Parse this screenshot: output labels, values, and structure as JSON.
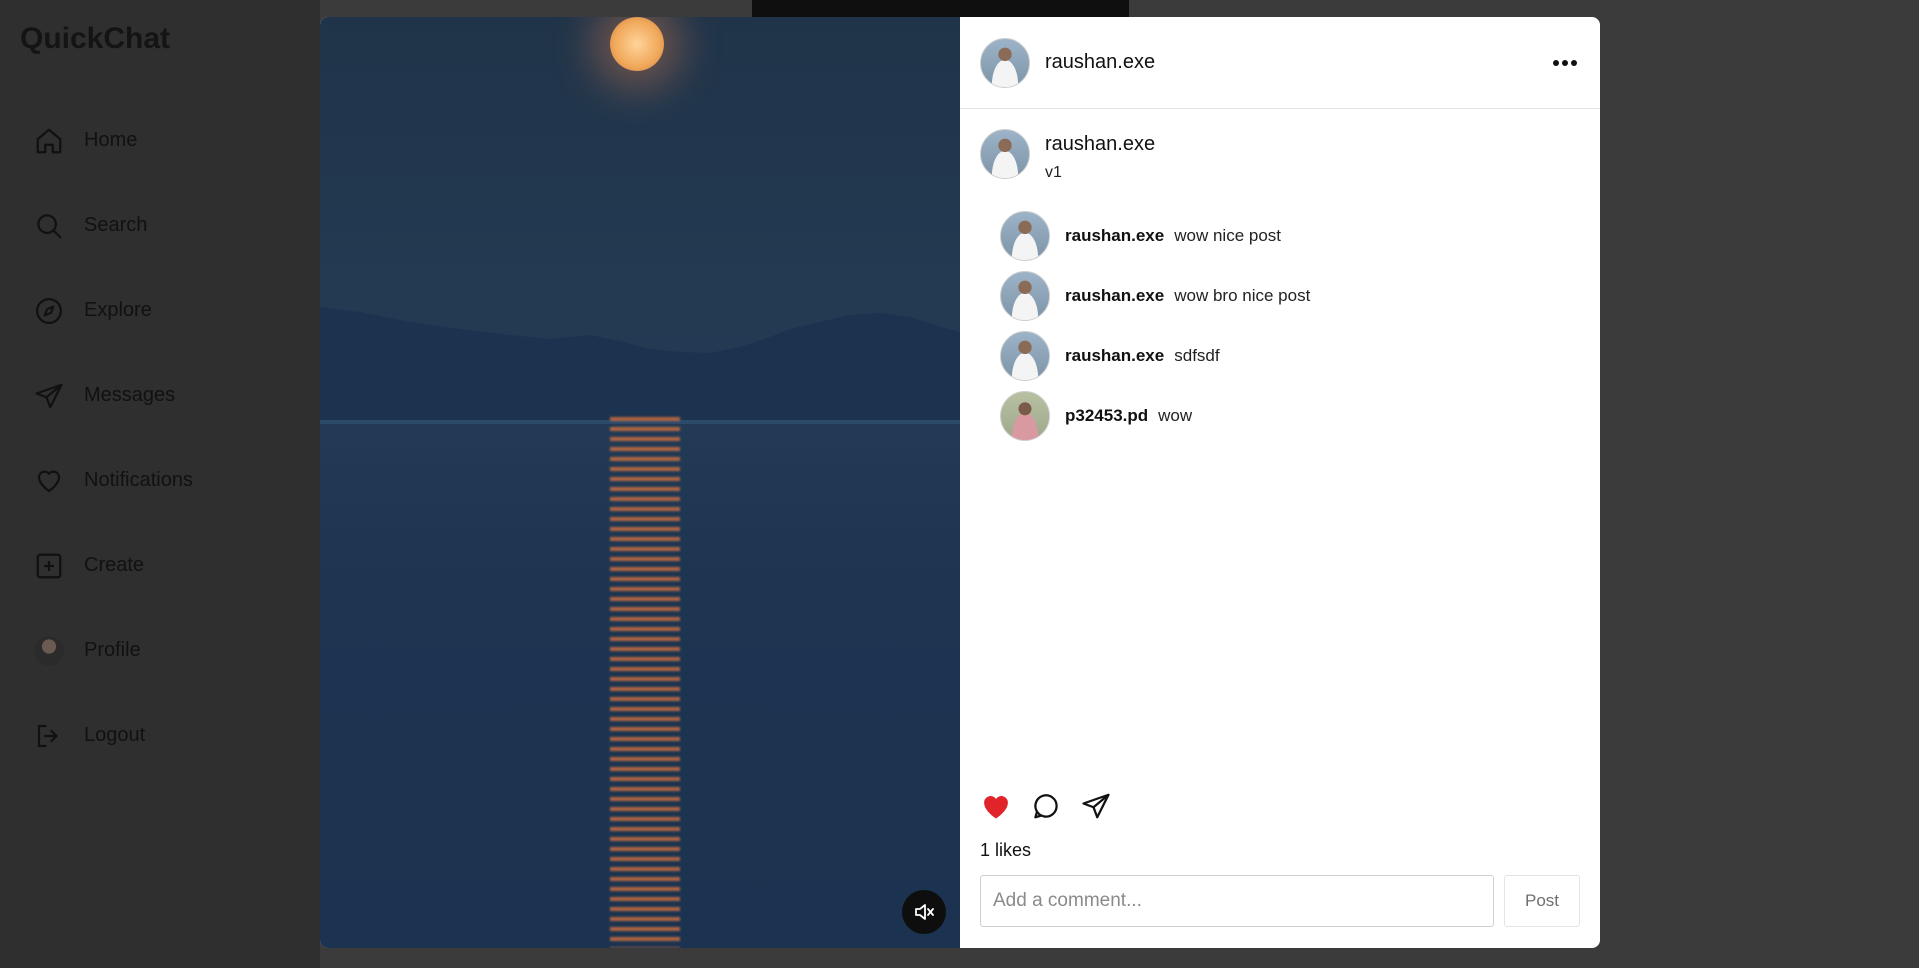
{
  "app": {
    "brand": "QuickChat"
  },
  "sidebar": {
    "items": [
      {
        "label": "Home",
        "icon": "home-icon"
      },
      {
        "label": "Search",
        "icon": "search-icon"
      },
      {
        "label": "Explore",
        "icon": "compass-icon"
      },
      {
        "label": "Messages",
        "icon": "send-icon"
      },
      {
        "label": "Notifications",
        "icon": "heart-icon"
      },
      {
        "label": "Create",
        "icon": "plus-square-icon"
      },
      {
        "label": "Profile",
        "icon": "avatar"
      },
      {
        "label": "Logout",
        "icon": "logout-icon"
      }
    ]
  },
  "post": {
    "author": "raushan.exe",
    "caption_user": "raushan.exe",
    "caption": "v1",
    "likes_text": "1 likes",
    "liked": true,
    "like_color": "#e0242a",
    "media_muted": true
  },
  "comments": [
    {
      "user": "raushan.exe",
      "text": "wow nice post"
    },
    {
      "user": "raushan.exe",
      "text": "wow bro nice post"
    },
    {
      "user": "raushan.exe",
      "text": "sdfsdf"
    },
    {
      "user": "p32453.pd",
      "text": "wow"
    }
  ],
  "composer": {
    "placeholder": "Add a comment...",
    "post_label": "Post"
  }
}
